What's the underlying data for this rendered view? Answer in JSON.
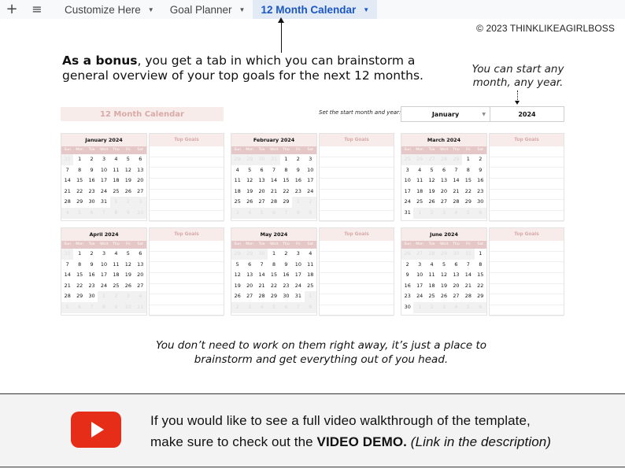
{
  "tabbar": {
    "add_icon": "+",
    "menu_icon": "≡",
    "tabs": [
      {
        "label": "Customize Here",
        "active": false
      },
      {
        "label": "Goal Planner",
        "active": false
      },
      {
        "label": "12 Month Calendar",
        "active": true
      }
    ]
  },
  "copyright": "©  2023 THINKLIKEAGIRLBOSS",
  "intro": {
    "bold": "As a bonus",
    "rest_line1": ", you get a tab in which you can brainstorm a",
    "line2": "general overview of your top goals for the next 12 months."
  },
  "note_right": {
    "line1": "You can start any",
    "line2": "month, any year."
  },
  "sheet": {
    "title": "12 Month Calendar",
    "start_label": "Set the start month and year:",
    "start_month": "January",
    "start_year": "2024",
    "weekdays": [
      "Sun",
      "Mon",
      "Tue",
      "Wed",
      "Thu",
      "Fri",
      "Sat"
    ],
    "goals_title": "Top Goals",
    "months": [
      {
        "title": "January 2024",
        "weeks": [
          [
            31,
            1,
            2,
            3,
            4,
            5,
            6
          ],
          [
            7,
            8,
            9,
            10,
            11,
            12,
            13
          ],
          [
            14,
            15,
            16,
            17,
            18,
            19,
            20
          ],
          [
            21,
            22,
            23,
            24,
            25,
            26,
            27
          ],
          [
            28,
            29,
            30,
            31,
            1,
            2,
            3
          ],
          [
            4,
            5,
            6,
            7,
            8,
            9,
            10
          ]
        ],
        "lead": 1,
        "days": 31
      },
      {
        "title": "February 2024",
        "weeks": [
          [
            28,
            29,
            30,
            31,
            1,
            2,
            3
          ],
          [
            4,
            5,
            6,
            7,
            8,
            9,
            10
          ],
          [
            11,
            12,
            13,
            14,
            15,
            16,
            17
          ],
          [
            18,
            19,
            20,
            21,
            22,
            23,
            24
          ],
          [
            25,
            26,
            27,
            28,
            29,
            1,
            2
          ],
          [
            3,
            4,
            5,
            6,
            7,
            8,
            9
          ]
        ],
        "lead": 4,
        "days": 29
      },
      {
        "title": "March 2024",
        "weeks": [
          [
            25,
            26,
            27,
            28,
            29,
            1,
            2
          ],
          [
            3,
            4,
            5,
            6,
            7,
            8,
            9
          ],
          [
            10,
            11,
            12,
            13,
            14,
            15,
            16
          ],
          [
            17,
            18,
            19,
            20,
            21,
            22,
            23
          ],
          [
            24,
            25,
            26,
            27,
            28,
            29,
            30
          ],
          [
            31,
            1,
            2,
            3,
            4,
            5,
            6
          ]
        ],
        "lead": 5,
        "days": 31
      },
      {
        "title": "April 2024",
        "weeks": [
          [
            31,
            1,
            2,
            3,
            4,
            5,
            6
          ],
          [
            7,
            8,
            9,
            10,
            11,
            12,
            13
          ],
          [
            14,
            15,
            16,
            17,
            18,
            19,
            20
          ],
          [
            21,
            22,
            23,
            24,
            25,
            26,
            27
          ],
          [
            28,
            29,
            30,
            1,
            2,
            3,
            4
          ],
          [
            5,
            6,
            7,
            8,
            9,
            10,
            11
          ]
        ],
        "lead": 1,
        "days": 30
      },
      {
        "title": "May 2024",
        "weeks": [
          [
            28,
            29,
            30,
            1,
            2,
            3,
            4
          ],
          [
            5,
            6,
            7,
            8,
            9,
            10,
            11
          ],
          [
            12,
            13,
            14,
            15,
            16,
            17,
            18
          ],
          [
            19,
            20,
            21,
            22,
            23,
            24,
            25
          ],
          [
            26,
            27,
            28,
            29,
            30,
            31,
            1
          ],
          [
            2,
            3,
            4,
            5,
            6,
            7,
            8
          ]
        ],
        "lead": 3,
        "days": 31
      },
      {
        "title": "June 2024",
        "weeks": [
          [
            26,
            27,
            28,
            29,
            30,
            31,
            1
          ],
          [
            2,
            3,
            4,
            5,
            6,
            7,
            8
          ],
          [
            9,
            10,
            11,
            12,
            13,
            14,
            15
          ],
          [
            16,
            17,
            18,
            19,
            20,
            21,
            22
          ],
          [
            23,
            24,
            25,
            26,
            27,
            28,
            29
          ],
          [
            30,
            1,
            2,
            3,
            4,
            5,
            6
          ]
        ],
        "lead": 6,
        "days": 30
      }
    ]
  },
  "bottom_note": {
    "line1": "You don’t need to work on them right away, it’s just a place to",
    "line2": "brainstorm and get everything out of you head."
  },
  "video_banner": {
    "icon": "youtube-play-icon",
    "line1": "If you would like to see a full video walkthrough of the template,",
    "line2_pre": "make sure to check out the ",
    "line2_bold": "VIDEO DEMO.",
    "line2_italic": " (Link in the description)",
    "brand_color": "#e52d18"
  }
}
